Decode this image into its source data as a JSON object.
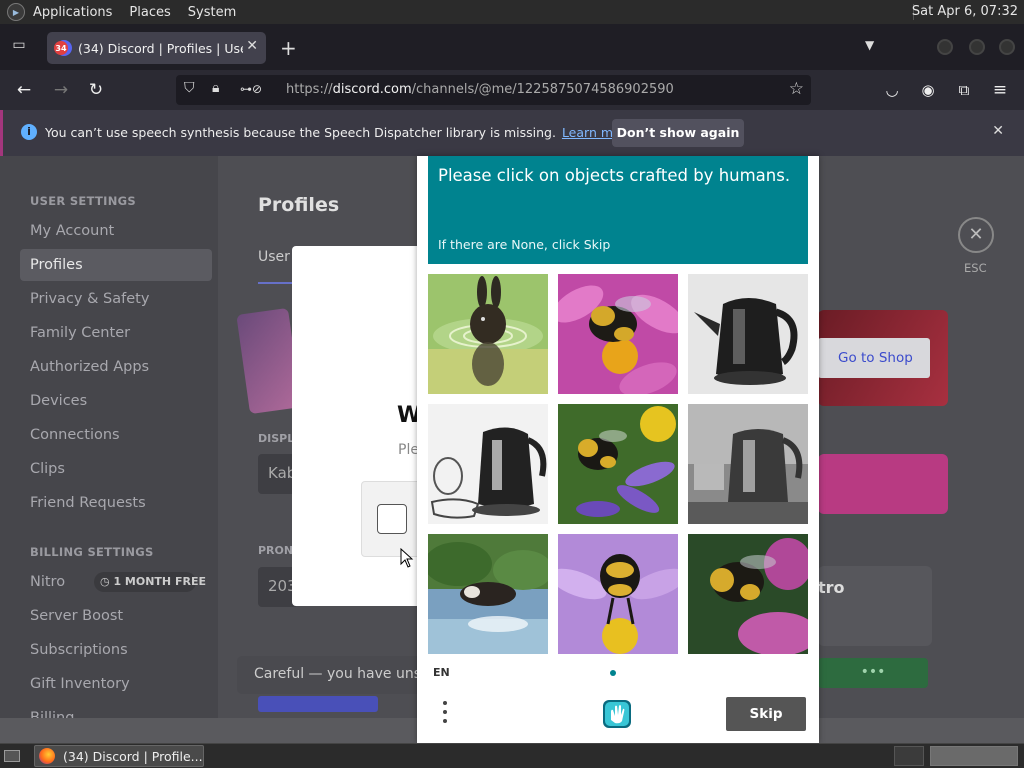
{
  "gnome_panel": {
    "menus": [
      "Applications",
      "Places",
      "System"
    ],
    "clock": "Sat Apr  6, 07:32"
  },
  "browser": {
    "tab": {
      "badge": "34",
      "title": "(34) Discord | Profiles | User Settings"
    },
    "url": {
      "scheme": "https://",
      "domain": "discord.com",
      "path": "/channels/@me/1225875074586902590"
    }
  },
  "notification": {
    "message": "You can’t use speech synthesis because the Speech Dispatcher library is missing.",
    "link": "Learn more",
    "button": "Don’t show again"
  },
  "discord": {
    "sidebar": {
      "user_settings_header": "USER SETTINGS",
      "user_items": [
        "My Account",
        "Profiles",
        "Privacy & Safety",
        "Family Center",
        "Authorized Apps",
        "Devices",
        "Connections",
        "Clips",
        "Friend Requests"
      ],
      "active_item": "Profiles",
      "billing_header": "BILLING SETTINGS",
      "billing_items": [
        "Nitro",
        "Server Boost",
        "Subscriptions",
        "Gift Inventory",
        "Billing"
      ],
      "nitro_badge": "1 MONTH FREE"
    },
    "main": {
      "title": "Profiles",
      "tab": "User",
      "display_label": "DISPL",
      "display_value": "Kab",
      "pronouns_label": "PRON",
      "pronouns_value": "203",
      "shop_button": "Go to Shop",
      "nitro_text": "tro",
      "unsaved_text": "Careful — you have unsa",
      "esc_label": "ESC"
    },
    "verify_modal": {
      "title": "W",
      "subtitle": "Ple"
    }
  },
  "captcha": {
    "prompt": "Please click on objects crafted by humans.",
    "subtext": "If there are None, click Skip",
    "tiles": [
      {
        "subject": "rabbit-in-water"
      },
      {
        "subject": "bee-on-pink-flower"
      },
      {
        "subject": "kettle-black"
      },
      {
        "subject": "kettle-sketch"
      },
      {
        "subject": "bee-on-purple-flower"
      },
      {
        "subject": "kettle-grey"
      },
      {
        "subject": "cow-leaping-over-water"
      },
      {
        "subject": "bee-on-lilac-flower"
      },
      {
        "subject": "bee-on-magenta-flower"
      }
    ],
    "language": "EN",
    "skip_label": "Skip"
  },
  "taskbar": {
    "task_title": "(34) Discord | Profile..."
  },
  "colors": {
    "captcha_teal": "#00838f",
    "discord_blurple": "#5865f2",
    "skip_button": "#555555"
  }
}
